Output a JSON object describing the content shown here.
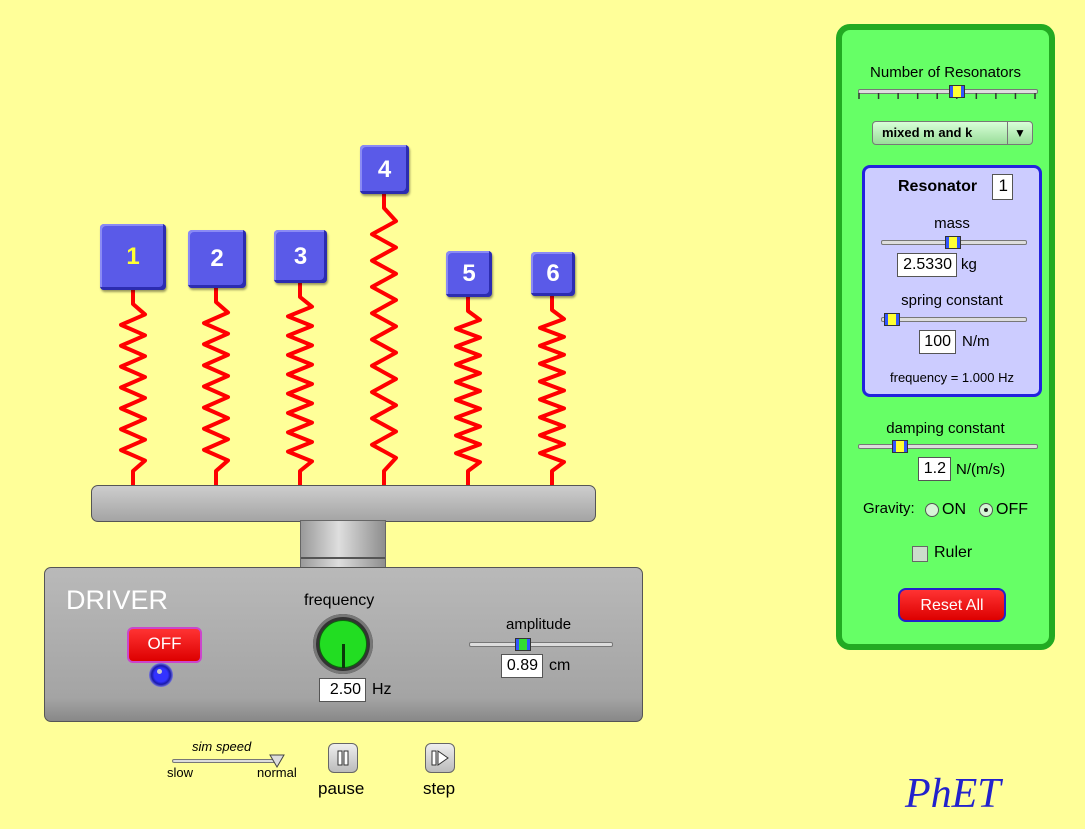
{
  "resonators": [
    {
      "label": "1",
      "selected": true
    },
    {
      "label": "2"
    },
    {
      "label": "3"
    },
    {
      "label": "4"
    },
    {
      "label": "5"
    },
    {
      "label": "6"
    }
  ],
  "driver": {
    "title": "DRIVER",
    "power_button": "OFF",
    "frequency_label": "frequency",
    "frequency_value": "2.50",
    "frequency_unit": "Hz",
    "amplitude_label": "amplitude",
    "amplitude_value": "0.89",
    "amplitude_unit": "cm"
  },
  "sim_speed": {
    "label": "sim speed",
    "slow_label": "slow",
    "normal_label": "normal",
    "level": 1.0
  },
  "playback": {
    "pause_label": "pause",
    "step_label": "step"
  },
  "panel": {
    "num_resonators_label": "Number of Resonators",
    "num_resonators_value": 6,
    "num_resonators_max": 10,
    "mode_dropdown": "mixed m and k",
    "resonator_title": "Resonator",
    "resonator_index": "1",
    "mass_label": "mass",
    "mass_value": "2.5330",
    "mass_unit": "kg",
    "spring_label": "spring constant",
    "spring_value": "100",
    "spring_unit": "N/m",
    "frequency_text": "frequency = 1.000 Hz",
    "damping_label": "damping constant",
    "damping_value": "1.2",
    "damping_unit": "N/(m/s)",
    "gravity_label": "Gravity:",
    "gravity_on": "ON",
    "gravity_off": "OFF",
    "gravity_selected": "OFF",
    "ruler_label": "Ruler",
    "ruler_checked": false,
    "reset_label": "Reset All"
  },
  "brand": "PhET",
  "colors": {
    "background": "#ffff99",
    "block": "#5a5ae8",
    "spring": "#ff0000",
    "panel": "#66ff66",
    "panel_border": "#22aa22",
    "reset": "#ff0000"
  }
}
